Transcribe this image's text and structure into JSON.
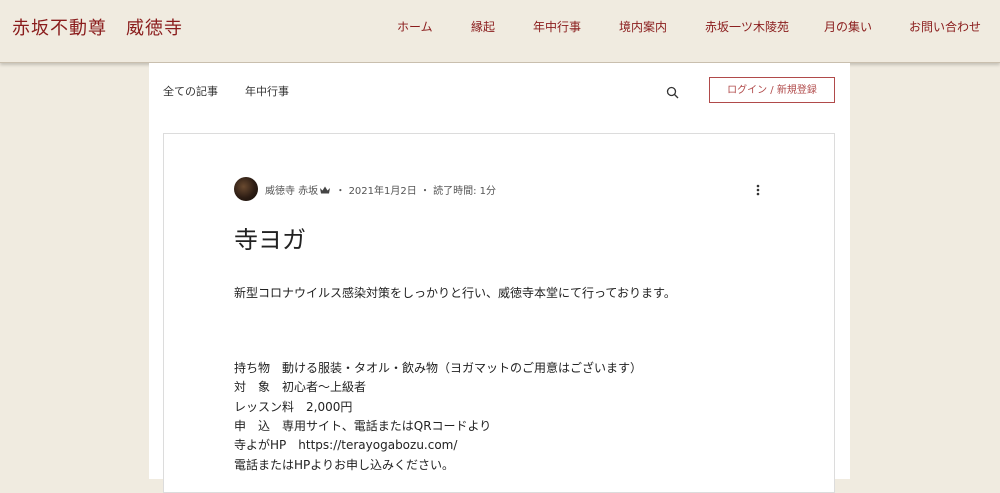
{
  "header": {
    "site_title": "赤坂不動尊　威徳寺",
    "nav": [
      "ホーム",
      "縁起",
      "年中行事",
      "境内案内",
      "赤坂一ツ木陵苑",
      "月の集い",
      "お問い合わせ"
    ]
  },
  "blog_nav": {
    "tabs": [
      "全ての記事",
      "年中行事"
    ],
    "login_label": "ログイン / 新規登録"
  },
  "post": {
    "author": "威徳寺 赤坂",
    "date": "2021年1月2日",
    "read_time": "読了時間: 1分",
    "separator": "・",
    "title": "寺ヨガ",
    "intro": "新型コロナウイルス感染対策をしっかりと行い、威徳寺本堂にて行っております。",
    "details": [
      "持ち物　動ける服装・タオル・飲み物（ヨガマットのご用意はございます）",
      "対　象　初心者〜上級者",
      "レッスン料　2,000円",
      "申　込　専用サイト、電話またはQRコードより",
      "寺よがHP　https://terayogabozu.com/",
      "電話またはHPよりお申し込みください。"
    ]
  },
  "icons": {
    "search": "search-icon",
    "more": "more-options-icon",
    "crown": "crown-icon"
  },
  "colors": {
    "background": "#f0ebe0",
    "accent": "#8a1c1c",
    "login_border": "#b04a4a"
  }
}
